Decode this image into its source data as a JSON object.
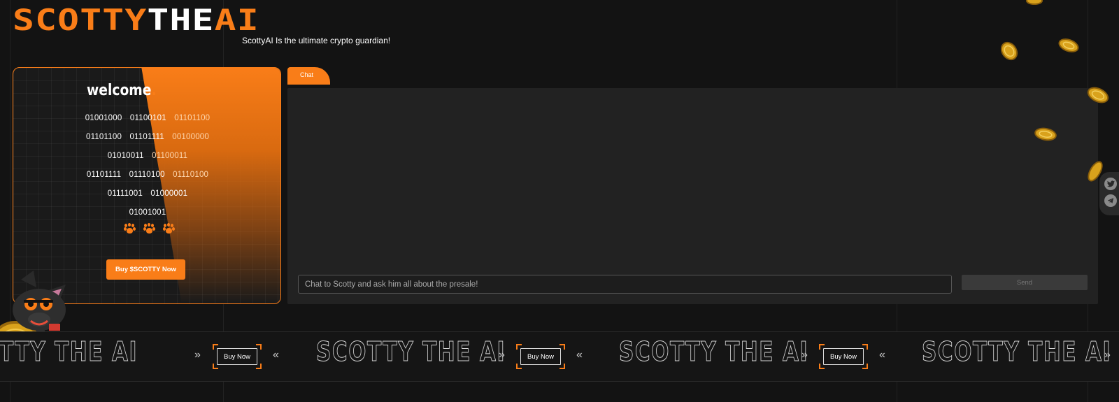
{
  "brand": {
    "logo_part1": "SCOTTY",
    "logo_part2": "THE",
    "logo_part3": "AI",
    "tagline": "ScottyAI Is the ultimate crypto guardian!",
    "accent": "#f97d18"
  },
  "welcome": {
    "title": "welcome",
    "title_dot": ".",
    "binary_rows": [
      [
        "01001000",
        "01100101",
        "01101100"
      ],
      [
        "01101100",
        "01101111",
        "00100000"
      ],
      [
        "01010011",
        "01100011"
      ],
      [
        "01101111",
        "01110100",
        "01110100"
      ],
      [
        "01111001",
        "01000001"
      ],
      [
        "01001001"
      ]
    ],
    "buy_button": "Buy $SCOTTY Now"
  },
  "chat": {
    "tab_label": "Chat",
    "input_placeholder": "Chat to Scotty and ask him all about the presale!",
    "send_label": "Send"
  },
  "social": {
    "icons": [
      "twitter-icon",
      "telegram-icon"
    ]
  },
  "marquee": {
    "text": "SCOTTY THE AI",
    "button": "Buy Now",
    "arrow_right": "»",
    "arrow_left": "«"
  }
}
